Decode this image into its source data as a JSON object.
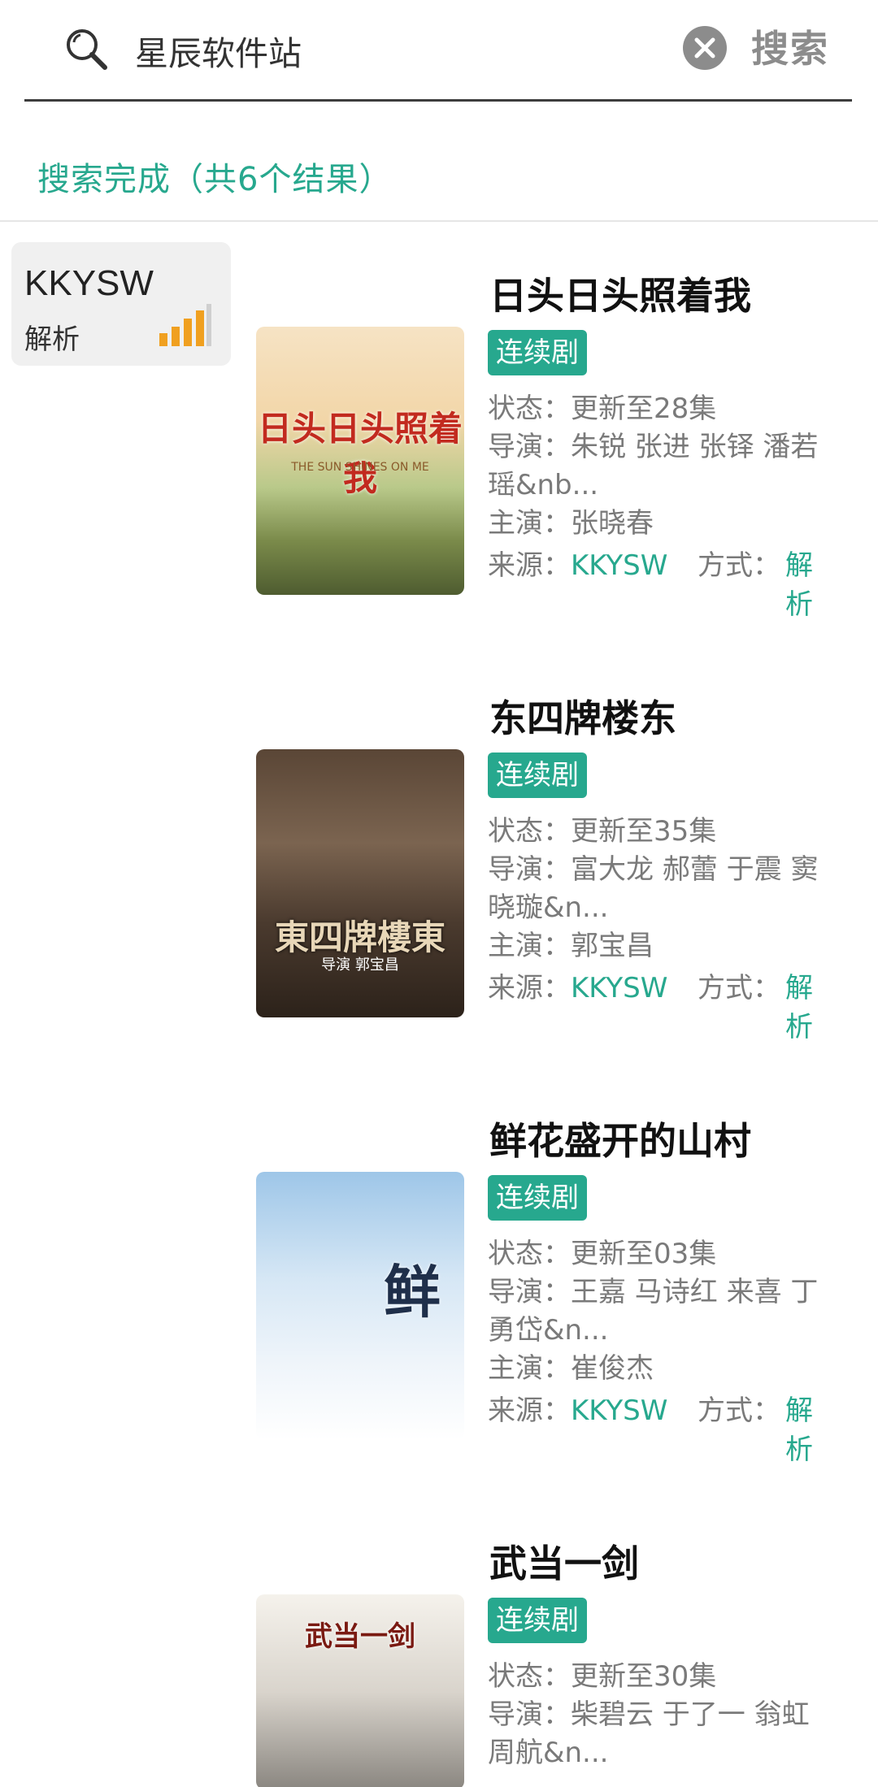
{
  "search": {
    "query": "星辰软件站",
    "button_label": "搜索",
    "status": "搜索完成（共6个结果）"
  },
  "source": {
    "name": "KKYSW",
    "type": "解析"
  },
  "labels": {
    "status": "状态：",
    "director": "导演：",
    "actor": "主演：",
    "source": "来源：",
    "method": "方式："
  },
  "results": [
    {
      "title": "日头日头照着我",
      "tag": "连续剧",
      "status": "更新至28集",
      "director": "朱锐 张进 张铎 潘若瑶&nb...",
      "actor": "张晓春",
      "source": "KKYSW",
      "method": "解析",
      "poster_text": "日头日头照着我",
      "poster_sub": "THE SUN SHINES ON ME"
    },
    {
      "title": "东四牌楼东",
      "tag": "连续剧",
      "status": "更新至35集",
      "director": "富大龙 郝蕾 于震 窦晓璇&n...",
      "actor": "郭宝昌",
      "source": "KKYSW",
      "method": "解析",
      "poster_text": "東四牌樓東",
      "poster_sub": "导演 郭宝昌"
    },
    {
      "title": "鲜花盛开的山村",
      "tag": "连续剧",
      "status": "更新至03集",
      "director": "王嘉 马诗红 来喜 丁勇岱&n...",
      "actor": "崔俊杰",
      "source": "KKYSW",
      "method": "解析",
      "poster_text": "鲜",
      "poster_sub": ""
    },
    {
      "title": "武当一剑",
      "tag": "连续剧",
      "status": "更新至30集",
      "director": "柴碧云 于了一 翁虹 周航&n...",
      "actor": "",
      "source": "",
      "method": "",
      "poster_text": "武当一剑",
      "poster_sub": ""
    }
  ],
  "colors": {
    "accent": "#27a88e",
    "text_gray": "#7a7a7a"
  }
}
